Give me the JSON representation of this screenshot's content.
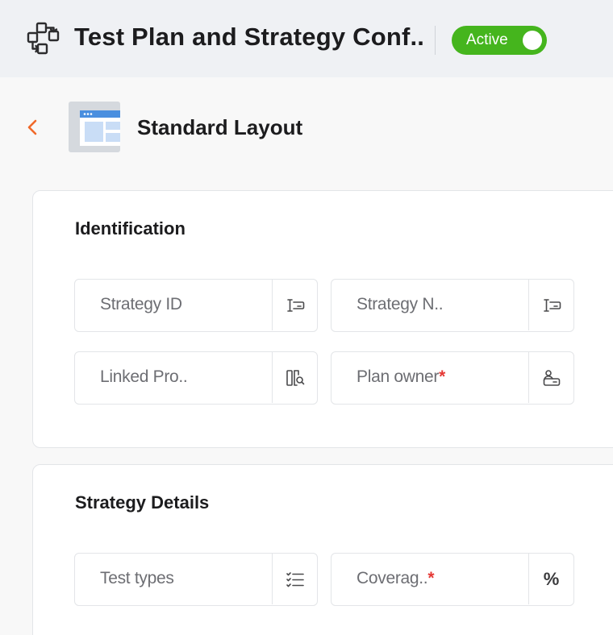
{
  "header": {
    "title": "Test Plan and Strategy Conf..",
    "status_label": "Active",
    "app_icon": "workflow-blocks-icon"
  },
  "layout": {
    "name": "Standard Layout",
    "back_icon": "chevron-left-icon",
    "thumbnail_icon": "layout-thumbnail-icon"
  },
  "colors": {
    "accent_toggle": "#45b51d",
    "back_arrow": "#f0692a",
    "required": "#e53935"
  },
  "sections": [
    {
      "title": "Identification",
      "fields": [
        {
          "label": "Strategy ID",
          "required": "",
          "icon": "auto-number-icon"
        },
        {
          "label": "Strategy N..",
          "required": "",
          "icon": "text-field-icon"
        },
        {
          "label": "Linked Pro..",
          "required": "",
          "icon": "lookup-icon"
        },
        {
          "label": "Plan owner",
          "required": "*",
          "icon": "user-field-icon"
        }
      ]
    },
    {
      "title": "Strategy Details",
      "fields": [
        {
          "label": "Test types",
          "required": "",
          "icon": "multi-select-icon"
        },
        {
          "label": "Coverag..",
          "required": "*",
          "icon": "percent-icon",
          "icon_text": "%"
        }
      ]
    }
  ]
}
